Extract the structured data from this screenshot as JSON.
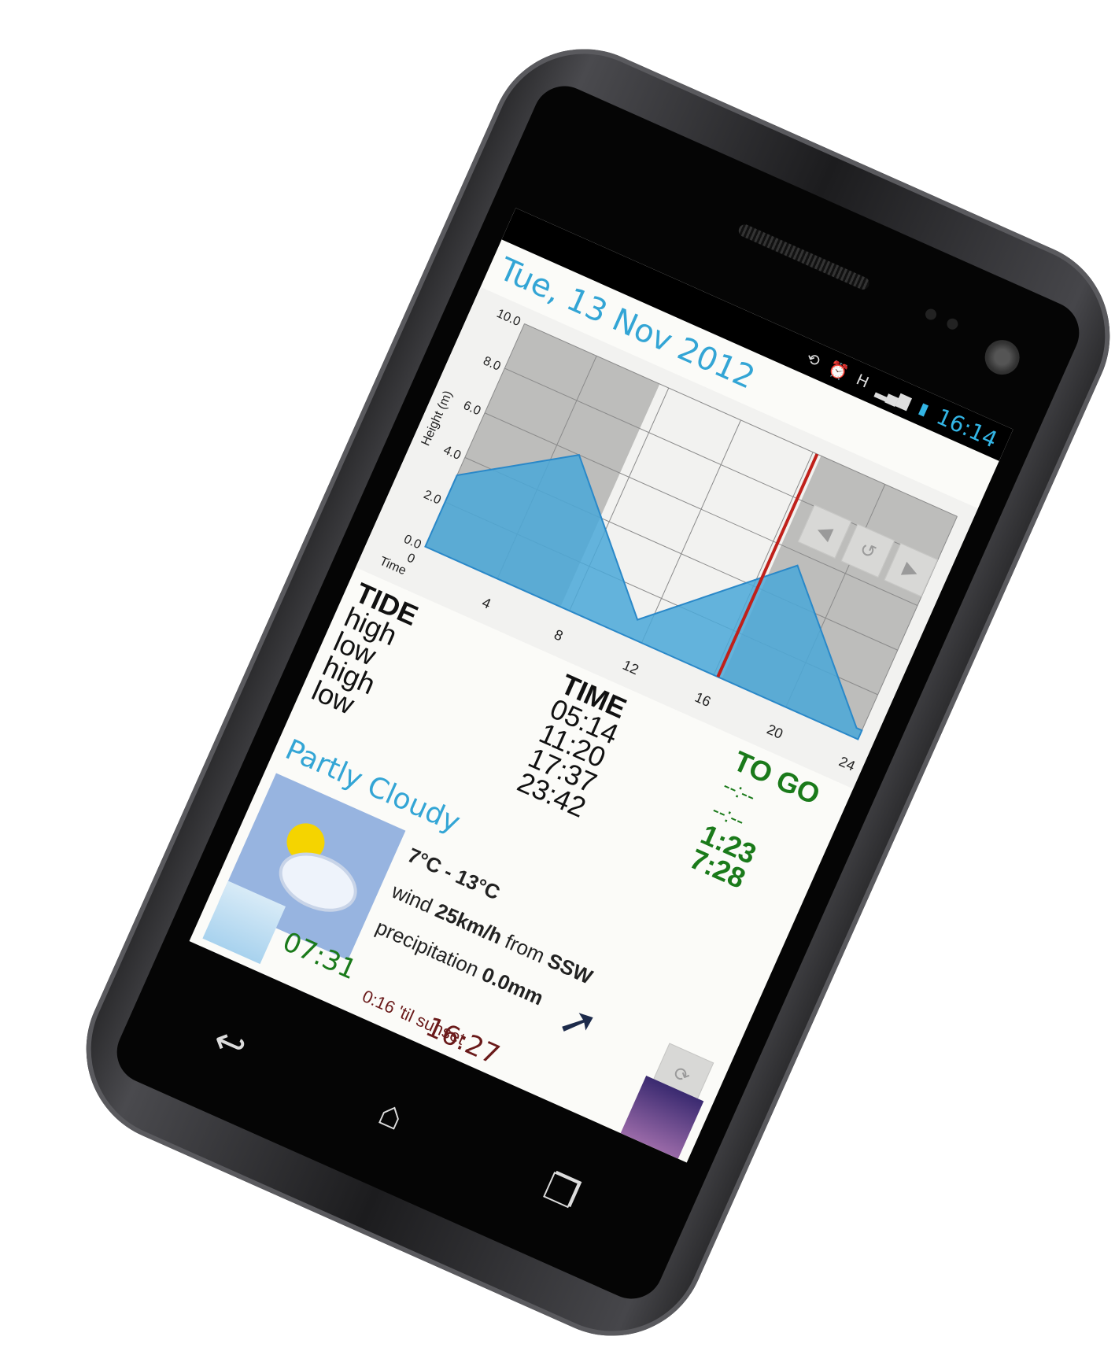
{
  "status_bar": {
    "network": "H",
    "clock": "16:14"
  },
  "date": "Tue, 13 Nov 2012",
  "chart_data": {
    "type": "area",
    "y_label": "Height (m)",
    "x_label": "Time",
    "y_ticks": [
      "10.0",
      "8.0",
      "6.0",
      "4.0",
      "2.0",
      "0.0"
    ],
    "y_zero_label": "0",
    "x_ticks": [
      "4",
      "8",
      "12",
      "16",
      "20",
      "24"
    ],
    "x": [
      0,
      5.23,
      11.33,
      17.62,
      23.7,
      24
    ],
    "y": [
      3.2,
      6.0,
      0.8,
      5.5,
      0.4,
      0.4
    ],
    "current_time_marker": 16.23,
    "ylim": [
      0,
      10
    ],
    "xlim": [
      0,
      24
    ],
    "night_shading": [
      [
        0,
        7.5
      ],
      [
        16.45,
        24
      ]
    ],
    "grid": true
  },
  "nav_buttons": {
    "prev": "◀",
    "reset": "↺",
    "next": "▶"
  },
  "tide": {
    "header": "TIDE",
    "rows": [
      "high",
      "low",
      "high",
      "low"
    ],
    "time_header": "TIME",
    "times": [
      "05:14",
      "11:20",
      "17:37",
      "23:42"
    ],
    "togo_header": "TO GO",
    "togo": [
      "--:--",
      "--:--",
      "1:23",
      "7:28"
    ]
  },
  "weather": {
    "title": "Partly Cloudy",
    "temp": "7°C - 13°C",
    "wind_prefix": "wind ",
    "wind_speed": "25km/h",
    "wind_mid": " from ",
    "wind_dir": "SSW",
    "precip_prefix": "precipitation ",
    "precip_value": "0.0mm"
  },
  "sun": {
    "sunrise": "07:31",
    "sunset": "16:27",
    "sunset_countdown": "0:16 'til sunset"
  },
  "colors": {
    "accent": "#33a5d5",
    "tide_fill": "#4aa8d8",
    "marker": "#c0201a",
    "togo": "#1a7a1a",
    "sunset_text": "#6a1a1a"
  }
}
